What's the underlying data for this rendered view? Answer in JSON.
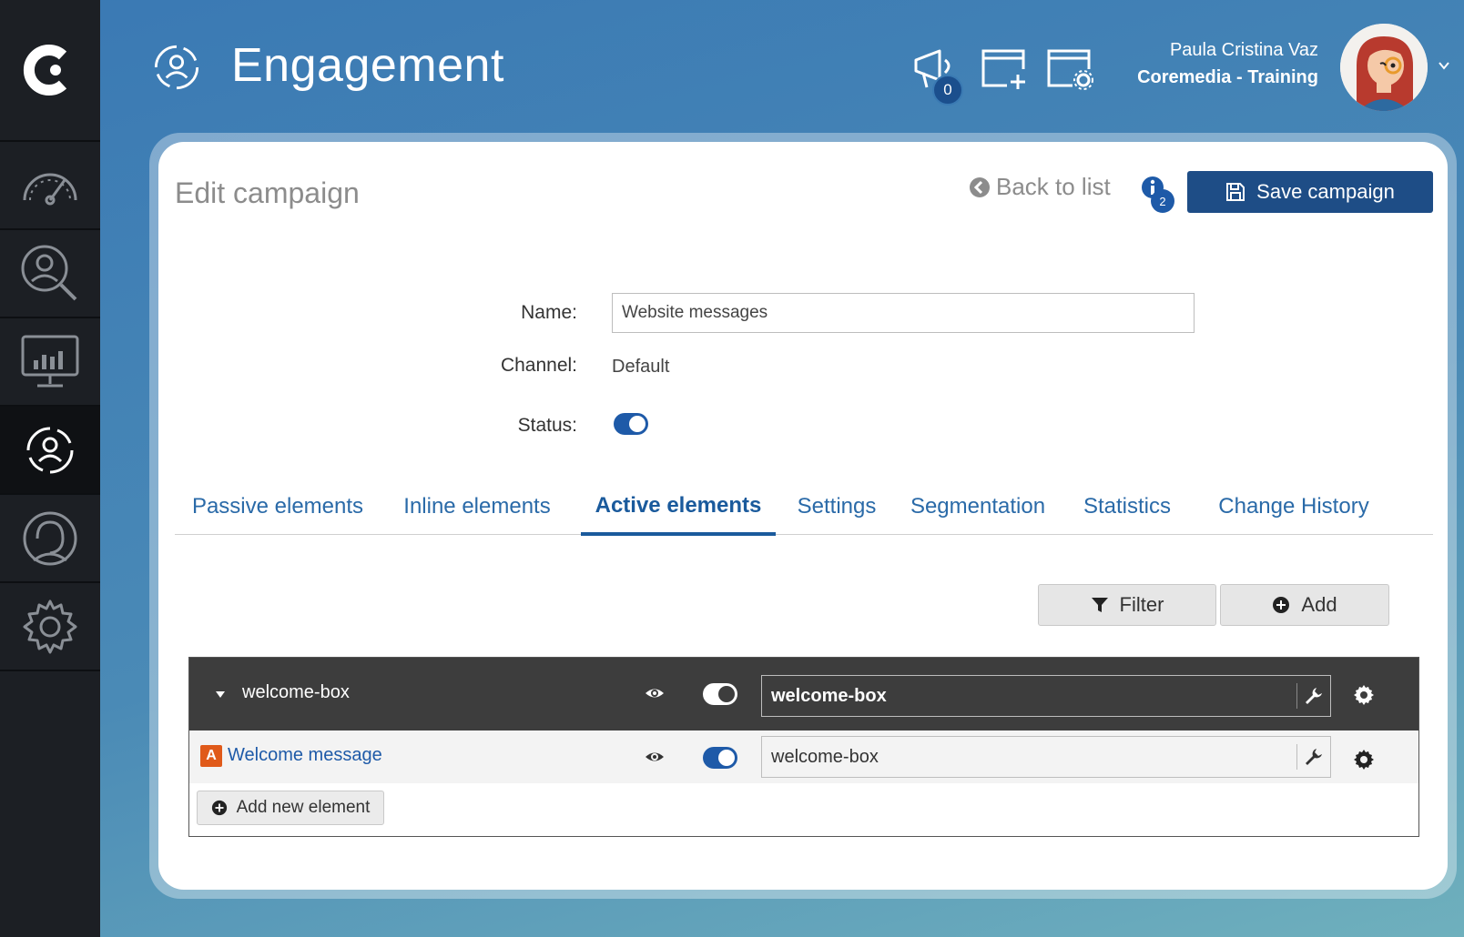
{
  "app": {
    "title": "Engagement",
    "notifications_count": "0"
  },
  "sidebar": {
    "items": [
      {
        "name": "dashboard"
      },
      {
        "name": "profile-search"
      },
      {
        "name": "analytics"
      },
      {
        "name": "engagement",
        "active": true
      },
      {
        "name": "support"
      },
      {
        "name": "settings"
      }
    ]
  },
  "user": {
    "name": "Paula Cristina Vaz",
    "organization": "Coremedia - Training"
  },
  "page": {
    "title": "Edit campaign",
    "back_label": "Back to list",
    "info_count": "2",
    "save_label": "Save campaign"
  },
  "form": {
    "name_label": "Name:",
    "name_value": "Website messages",
    "channel_label": "Channel:",
    "channel_value": "Default",
    "status_label": "Status:",
    "status_enabled": true
  },
  "tabs": [
    {
      "label": "Passive elements"
    },
    {
      "label": "Inline elements"
    },
    {
      "label": "Active elements",
      "active": true
    },
    {
      "label": "Settings"
    },
    {
      "label": "Segmentation"
    },
    {
      "label": "Statistics"
    },
    {
      "label": "Change History"
    }
  ],
  "toolbar": {
    "filter_label": "Filter",
    "add_label": "Add"
  },
  "elements": {
    "group": {
      "name": "welcome-box",
      "identifier": "welcome-box",
      "enabled": true
    },
    "items": [
      {
        "type_badge": "A",
        "name": "Welcome message",
        "identifier": "welcome-box",
        "enabled": true
      }
    ],
    "add_new_label": "Add new element"
  },
  "colors": {
    "accent": "#1e4d86",
    "link": "#2a6aa8",
    "sidebar": "#1c1f24",
    "group_row": "#3d3d3d",
    "badge_orange": "#e05a1a"
  }
}
